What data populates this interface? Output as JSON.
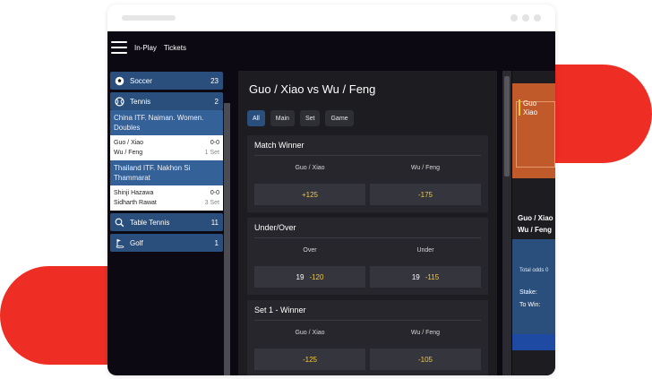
{
  "nav": {
    "links": [
      "In-Play",
      "Tickets"
    ]
  },
  "sports": [
    {
      "name": "Soccer",
      "count": "23",
      "icon": "soccer-ball-icon"
    },
    {
      "name": "Tennis",
      "count": "2",
      "icon": "tennis-ball-icon"
    },
    {
      "name": "Table Tennis",
      "count": "11",
      "icon": "table-tennis-icon"
    },
    {
      "name": "Golf",
      "count": "1",
      "icon": "golf-icon"
    }
  ],
  "tennis_leagues": [
    {
      "name": "China ITF. Naiman. Women. Doubles",
      "match": {
        "player1": "Guo / Xiao",
        "score1": "0-0",
        "player2": "Wu / Feng",
        "period": "1 Set"
      }
    },
    {
      "name": "Thailand ITF. Nakhon Si Thammarat",
      "match": {
        "player1": "Shinji Hazawa",
        "score1": "0-0",
        "player2": "Sidharth Rawat",
        "period": "3 Set"
      }
    }
  ],
  "main": {
    "title": "Guo / Xiao vs Wu / Feng",
    "tabs": [
      "All",
      "Main",
      "Set",
      "Game"
    ],
    "markets": [
      {
        "title": "Match Winner",
        "labels": [
          "Guo / Xiao",
          "Wu / Feng"
        ],
        "odds": [
          {
            "line": "",
            "price": "+125"
          },
          {
            "line": "",
            "price": "-175"
          }
        ]
      },
      {
        "title": "Under/Over",
        "labels": [
          "Over",
          "Under"
        ],
        "odds": [
          {
            "line": "19",
            "price": "-120"
          },
          {
            "line": "19",
            "price": "-115"
          }
        ]
      },
      {
        "title": "Set 1 - Winner",
        "labels": [
          "Guo / Xiao",
          "Wu / Feng"
        ],
        "odds": [
          {
            "line": "",
            "price": "-125"
          },
          {
            "line": "",
            "price": "-105"
          }
        ]
      }
    ]
  },
  "scoreboard": {
    "team1_short": "Guo\nXiao",
    "team1": "Guo / Xiao",
    "team2": "Wu / Feng"
  },
  "betslip": {
    "total_odds_label": "Total odds 0",
    "stake_label": "Stake:",
    "to_win_label": "To Win:"
  },
  "colors": {
    "accent_blue": "#2a4f7d",
    "odds_yellow": "#f0c83c",
    "brand_red": "#ee2e24",
    "background": "#0d0912"
  }
}
